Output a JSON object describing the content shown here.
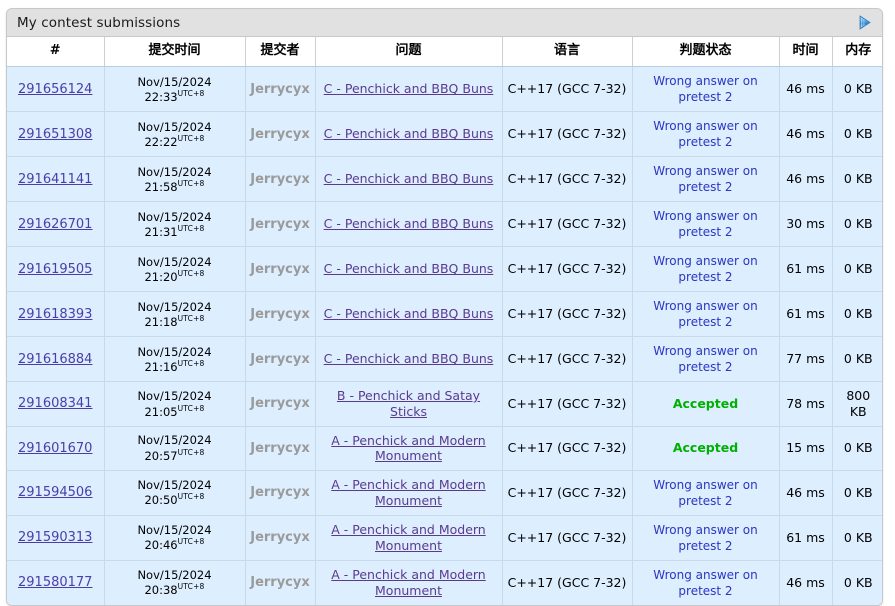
{
  "panel": {
    "title": "My contest submissions",
    "next_arrow_icon": "triangle-right-icon",
    "accent_color": "#3b8ede",
    "accepted_color": "#00b000",
    "verdict_link_color": "#2a36c4",
    "id_link_color": "#4b3ea8",
    "problem_link_color": "#5b3a8e",
    "author_color": "#9a9a9a",
    "row_bg_color": "#ddeeff",
    "header_bg_color": "#e1e1e1"
  },
  "table": {
    "columns": [
      {
        "key": "id",
        "label": "#"
      },
      {
        "key": "when",
        "label": "提交时间"
      },
      {
        "key": "who",
        "label": "提交者"
      },
      {
        "key": "problem",
        "label": "问题"
      },
      {
        "key": "lang",
        "label": "语言"
      },
      {
        "key": "verdict",
        "label": "判题状态"
      },
      {
        "key": "time",
        "label": "时间"
      },
      {
        "key": "memory",
        "label": "内存"
      }
    ],
    "rows": [
      {
        "id": "291656124",
        "date": "Nov/15/2024",
        "time_of_day": "22:33",
        "tz": "UTC+8",
        "who": "Jerrycyx",
        "problem": "C - Penchick and BBQ Buns",
        "lang": "C++17 (GCC 7-32)",
        "verdict": "Wrong answer on pretest 2",
        "verdict_state": "wrong",
        "time": "46 ms",
        "memory": "0 KB"
      },
      {
        "id": "291651308",
        "date": "Nov/15/2024",
        "time_of_day": "22:22",
        "tz": "UTC+8",
        "who": "Jerrycyx",
        "problem": "C - Penchick and BBQ Buns",
        "lang": "C++17 (GCC 7-32)",
        "verdict": "Wrong answer on pretest 2",
        "verdict_state": "wrong",
        "time": "46 ms",
        "memory": "0 KB"
      },
      {
        "id": "291641141",
        "date": "Nov/15/2024",
        "time_of_day": "21:58",
        "tz": "UTC+8",
        "who": "Jerrycyx",
        "problem": "C - Penchick and BBQ Buns",
        "lang": "C++17 (GCC 7-32)",
        "verdict": "Wrong answer on pretest 2",
        "verdict_state": "wrong",
        "time": "46 ms",
        "memory": "0 KB"
      },
      {
        "id": "291626701",
        "date": "Nov/15/2024",
        "time_of_day": "21:31",
        "tz": "UTC+8",
        "who": "Jerrycyx",
        "problem": "C - Penchick and BBQ Buns",
        "lang": "C++17 (GCC 7-32)",
        "verdict": "Wrong answer on pretest 2",
        "verdict_state": "wrong",
        "time": "30 ms",
        "memory": "0 KB"
      },
      {
        "id": "291619505",
        "date": "Nov/15/2024",
        "time_of_day": "21:20",
        "tz": "UTC+8",
        "who": "Jerrycyx",
        "problem": "C - Penchick and BBQ Buns",
        "lang": "C++17 (GCC 7-32)",
        "verdict": "Wrong answer on pretest 2",
        "verdict_state": "wrong",
        "time": "61 ms",
        "memory": "0 KB"
      },
      {
        "id": "291618393",
        "date": "Nov/15/2024",
        "time_of_day": "21:18",
        "tz": "UTC+8",
        "who": "Jerrycyx",
        "problem": "C - Penchick and BBQ Buns",
        "lang": "C++17 (GCC 7-32)",
        "verdict": "Wrong answer on pretest 2",
        "verdict_state": "wrong",
        "time": "61 ms",
        "memory": "0 KB"
      },
      {
        "id": "291616884",
        "date": "Nov/15/2024",
        "time_of_day": "21:16",
        "tz": "UTC+8",
        "who": "Jerrycyx",
        "problem": "C - Penchick and BBQ Buns",
        "lang": "C++17 (GCC 7-32)",
        "verdict": "Wrong answer on pretest 2",
        "verdict_state": "wrong",
        "time": "77 ms",
        "memory": "0 KB"
      },
      {
        "id": "291608341",
        "date": "Nov/15/2024",
        "time_of_day": "21:05",
        "tz": "UTC+8",
        "who": "Jerrycyx",
        "problem": "B - Penchick and Satay Sticks",
        "lang": "C++17 (GCC 7-32)",
        "verdict": "Accepted",
        "verdict_state": "accepted",
        "time": "78 ms",
        "memory": "800 KB"
      },
      {
        "id": "291601670",
        "date": "Nov/15/2024",
        "time_of_day": "20:57",
        "tz": "UTC+8",
        "who": "Jerrycyx",
        "problem": "A - Penchick and Modern Monument",
        "lang": "C++17 (GCC 7-32)",
        "verdict": "Accepted",
        "verdict_state": "accepted",
        "time": "15 ms",
        "memory": "0 KB"
      },
      {
        "id": "291594506",
        "date": "Nov/15/2024",
        "time_of_day": "20:50",
        "tz": "UTC+8",
        "who": "Jerrycyx",
        "problem": "A - Penchick and Modern Monument",
        "lang": "C++17 (GCC 7-32)",
        "verdict": "Wrong answer on pretest 2",
        "verdict_state": "wrong",
        "time": "46 ms",
        "memory": "0 KB"
      },
      {
        "id": "291590313",
        "date": "Nov/15/2024",
        "time_of_day": "20:46",
        "tz": "UTC+8",
        "who": "Jerrycyx",
        "problem": "A - Penchick and Modern Monument",
        "lang": "C++17 (GCC 7-32)",
        "verdict": "Wrong answer on pretest 2",
        "verdict_state": "wrong",
        "time": "61 ms",
        "memory": "0 KB"
      },
      {
        "id": "291580177",
        "date": "Nov/15/2024",
        "time_of_day": "20:38",
        "tz": "UTC+8",
        "who": "Jerrycyx",
        "problem": "A - Penchick and Modern Monument",
        "lang": "C++17 (GCC 7-32)",
        "verdict": "Wrong answer on pretest 2",
        "verdict_state": "wrong",
        "time": "46 ms",
        "memory": "0 KB"
      }
    ]
  }
}
